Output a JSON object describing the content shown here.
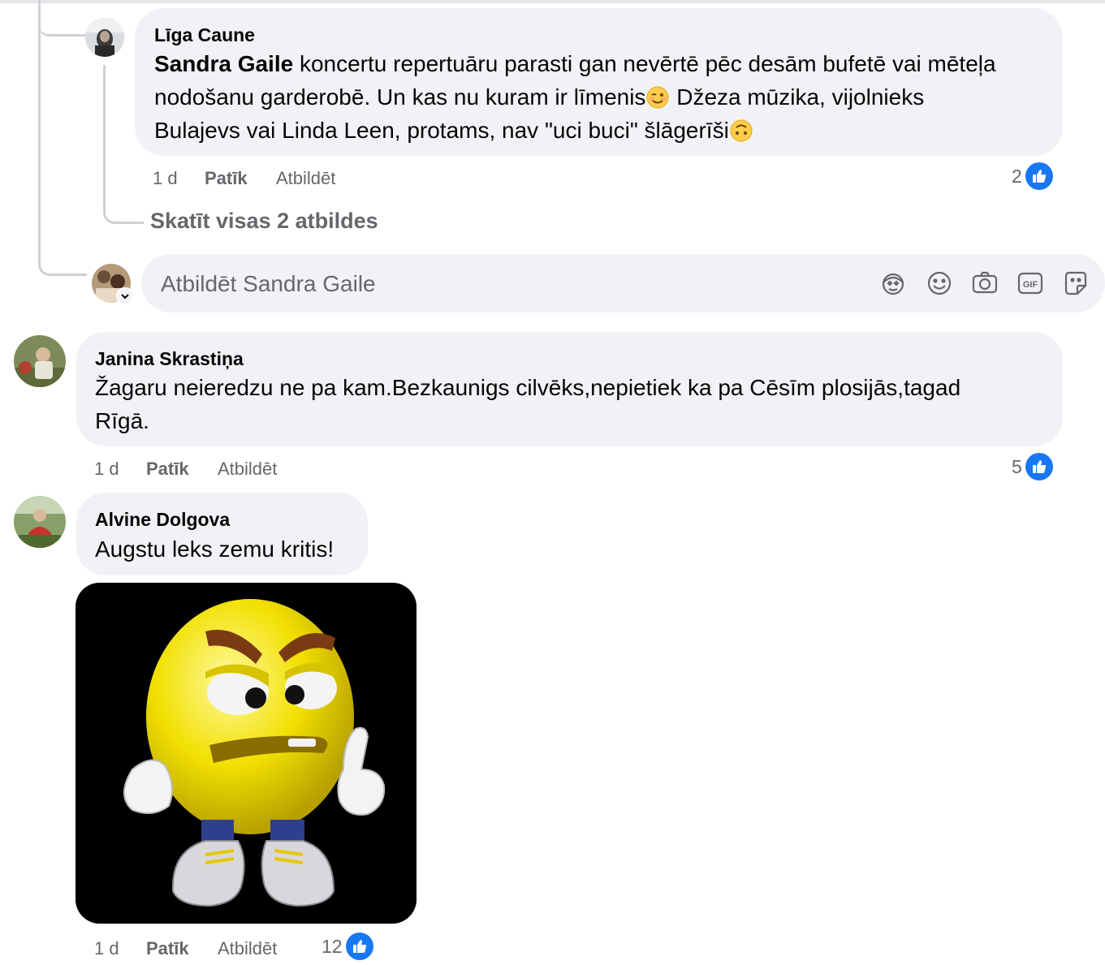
{
  "colors": {
    "bubble": "#f0f2f5",
    "meta_text": "#65676b",
    "like_blue": "#1877f2",
    "connector": "#ced0d4"
  },
  "comments": [
    {
      "author": "Līga Caune",
      "mention": "Sandra Gaile",
      "line1_rest": " koncertu repertuāru parasti gan nevērtē pēc desām bufetē vai mēteļa",
      "line2": "nodošanu garderobē. Un kas nu kuram ir līmenis",
      "line2_emoji": "winking-face-emoji",
      "line2_after": " Džeza mūzika, vijolnieks",
      "line3": "Bulajevs vai Linda Leen, protams, nav \"uci buci\" šlāgerīši",
      "line3_emoji": "upside-down-face-emoji",
      "time": "1 d",
      "like_label": "Patīk",
      "reply_label": "Atbildēt",
      "reactions": "2"
    },
    {
      "author": "Janina Skrastiņa",
      "line1": "Žagaru neieredzu ne pa kam.Bezkaunigs cilvēks,nepietiek ka pa Cēsīm plosijās,tagad",
      "line2": "Rīgā.",
      "time": "1 d",
      "like_label": "Patīk",
      "reply_label": "Atbildēt",
      "reactions": "5"
    },
    {
      "author": "Alvine Dolgova",
      "line1": "Augstu leks zemu kritis!",
      "attachment": "angry-emoji-sticker-image",
      "time": "1 d",
      "like_label": "Patīk",
      "reply_label": "Atbildēt",
      "reactions": "12"
    }
  ],
  "thread": {
    "view_all_replies": "Skatīt visas 2 atbildes"
  },
  "reply_composer": {
    "placeholder": "Atbildēt Sandra Gaile",
    "tools": [
      "avatar-sticker-icon",
      "emoji-icon",
      "camera-icon",
      "gif-icon",
      "sticker-icon"
    ],
    "gif_label": "GIF"
  }
}
